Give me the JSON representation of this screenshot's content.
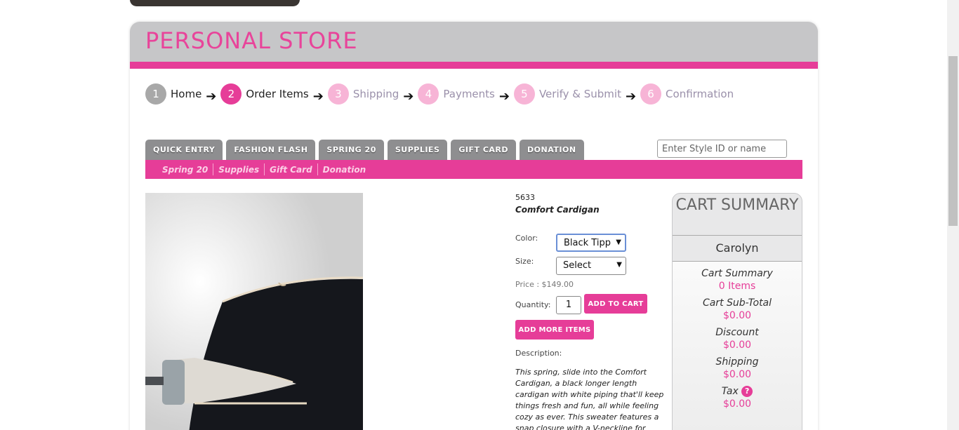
{
  "store": {
    "title": "PERSONAL STORE"
  },
  "steps": [
    {
      "num": "1",
      "label": "Home",
      "state": "done"
    },
    {
      "num": "2",
      "label": "Order Items",
      "state": "active"
    },
    {
      "num": "3",
      "label": "Shipping",
      "state": "todo"
    },
    {
      "num": "4",
      "label": "Payments",
      "state": "todo"
    },
    {
      "num": "5",
      "label": "Verify & Submit",
      "state": "todo"
    },
    {
      "num": "6",
      "label": "Confirmation",
      "state": "todo"
    }
  ],
  "tabs": [
    "QUICK ENTRY",
    "FASHION FLASH",
    "SPRING 20",
    "SUPPLIES",
    "GIFT CARD",
    "DONATION"
  ],
  "search": {
    "placeholder": "Enter Style ID or name"
  },
  "subnav": [
    "Spring 20",
    "Supplies",
    "Gift Card",
    "Donation"
  ],
  "product": {
    "style_id": "5633",
    "name": "Comfort Cardigan",
    "color_label": "Color:",
    "color_value": "Black Tipp",
    "size_label": "Size:",
    "size_value": "Select",
    "price": "Price : $149.00",
    "quantity_label": "Quantity:",
    "quantity_value": "1",
    "add_to_cart": "ADD TO CART",
    "add_more": "ADD MORE ITEMS",
    "description_label": "Description:",
    "description": "This spring, slide into the Comfort Cardigan, a black longer length cardigan with white piping that'll keep things fresh and fun, all while feeling cozy as ever. This sweater features a snap closure with a V-neckline for effortless style."
  },
  "cart": {
    "title": "CART SUMMARY",
    "user": "Carolyn",
    "summary_label": "Cart Summary",
    "items": "0 Items",
    "subtotal_label": "Cart Sub-Total",
    "subtotal": "$0.00",
    "discount_label": "Discount",
    "discount": "$0.00",
    "shipping_label": "Shipping",
    "shipping": "$0.00",
    "tax_label": "Tax",
    "tax": "$0.00"
  },
  "colors": {
    "accent": "#e63d98",
    "header_gray": "#c6c6c8",
    "tab_gray": "#8e8e90"
  }
}
